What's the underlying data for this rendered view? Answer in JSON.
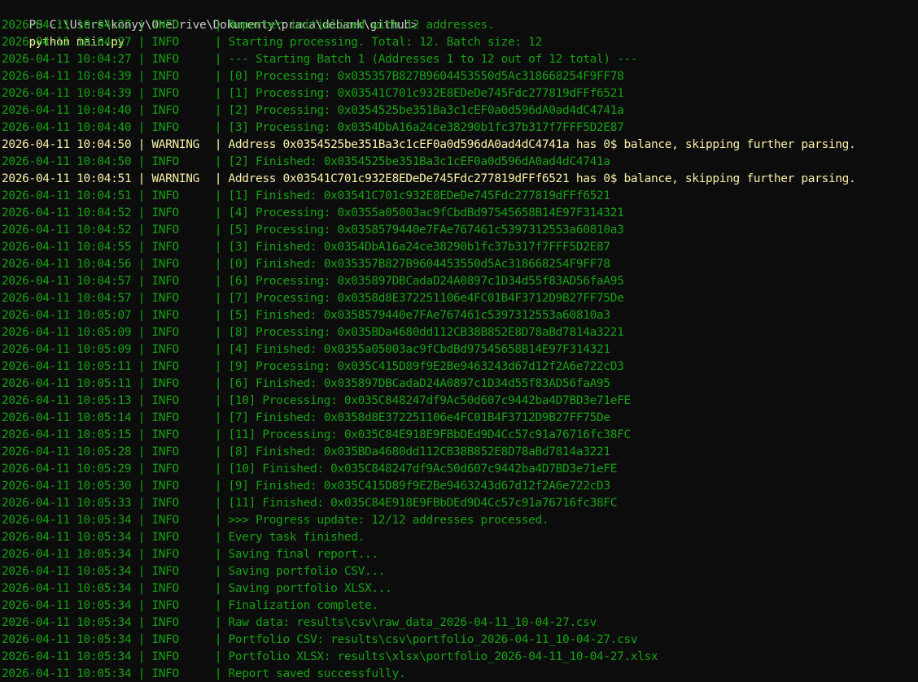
{
  "terminal": {
    "prompt": "PS C:\\Users\\konyy\\OneDrive\\Dokumenty\\praca\\debank\\github>",
    "command": "python main.py",
    "colors": {
      "background": "#0c0c0c",
      "info": "#13a10e",
      "warning": "#f9f1a5",
      "prompt": "#cccccc",
      "command": "#f9f1a5"
    },
    "lines": [
      {
        "ts": "2026-04-11 10:04:27",
        "level": "INFO",
        "msg": "Reporter initialized with 12 addresses."
      },
      {
        "ts": "2026-04-11 10:04:27",
        "level": "INFO",
        "msg": "Starting processing. Total: 12. Batch size: 12"
      },
      {
        "ts": "2026-04-11 10:04:27",
        "level": "INFO",
        "msg": "--- Starting Batch 1 (Addresses 1 to 12 out of 12 total) ---"
      },
      {
        "ts": "2026-04-11 10:04:39",
        "level": "INFO",
        "msg": "[0] Processing: 0x035357B827B9604453550d5Ac318668254F9FF78"
      },
      {
        "ts": "2026-04-11 10:04:39",
        "level": "INFO",
        "msg": "[1] Processing: 0x03541C701c932E8EDeDe745Fdc277819dFFf6521"
      },
      {
        "ts": "2026-04-11 10:04:40",
        "level": "INFO",
        "msg": "[2] Processing: 0x0354525be351Ba3c1cEF0a0d596dA0ad4dC4741a"
      },
      {
        "ts": "2026-04-11 10:04:40",
        "level": "INFO",
        "msg": "[3] Processing: 0x0354DbA16a24ce38290b1fc37b317f7FFF5D2E87"
      },
      {
        "ts": "2026-04-11 10:04:50",
        "level": "WARNING",
        "msg": "Address 0x0354525be351Ba3c1cEF0a0d596dA0ad4dC4741a has 0$ balance, skipping further parsing."
      },
      {
        "ts": "2026-04-11 10:04:50",
        "level": "INFO",
        "msg": "[2] Finished: 0x0354525be351Ba3c1cEF0a0d596dA0ad4dC4741a"
      },
      {
        "ts": "2026-04-11 10:04:51",
        "level": "WARNING",
        "msg": "Address 0x03541C701c932E8EDeDe745Fdc277819dFFf6521 has 0$ balance, skipping further parsing."
      },
      {
        "ts": "2026-04-11 10:04:51",
        "level": "INFO",
        "msg": "[1] Finished: 0x03541C701c932E8EDeDe745Fdc277819dFFf6521"
      },
      {
        "ts": "2026-04-11 10:04:52",
        "level": "INFO",
        "msg": "[4] Processing: 0x0355a05003ac9fCbdBd97545658B14E97F314321"
      },
      {
        "ts": "2026-04-11 10:04:52",
        "level": "INFO",
        "msg": "[5] Processing: 0x0358579440e7FAe767461c5397312553a60810a3"
      },
      {
        "ts": "2026-04-11 10:04:55",
        "level": "INFO",
        "msg": "[3] Finished: 0x0354DbA16a24ce38290b1fc37b317f7FFF5D2E87"
      },
      {
        "ts": "2026-04-11 10:04:56",
        "level": "INFO",
        "msg": "[0] Finished: 0x035357B827B9604453550d5Ac318668254F9FF78"
      },
      {
        "ts": "2026-04-11 10:04:57",
        "level": "INFO",
        "msg": "[6] Processing: 0x035897DBCadaD24A0897c1D34d55f83AD56faA95"
      },
      {
        "ts": "2026-04-11 10:04:57",
        "level": "INFO",
        "msg": "[7] Processing: 0x0358d8E372251106e4FC01B4F3712D9B27FF75De"
      },
      {
        "ts": "2026-04-11 10:05:07",
        "level": "INFO",
        "msg": "[5] Finished: 0x0358579440e7FAe767461c5397312553a60810a3"
      },
      {
        "ts": "2026-04-11 10:05:09",
        "level": "INFO",
        "msg": "[8] Processing: 0x035BDa4680dd112CB38B852E8D78aBd7814a3221"
      },
      {
        "ts": "2026-04-11 10:05:09",
        "level": "INFO",
        "msg": "[4] Finished: 0x0355a05003ac9fCbdBd97545658B14E97F314321"
      },
      {
        "ts": "2026-04-11 10:05:11",
        "level": "INFO",
        "msg": "[9] Processing: 0x035C415D89f9E2Be9463243d67d12f2A6e722cD3"
      },
      {
        "ts": "2026-04-11 10:05:11",
        "level": "INFO",
        "msg": "[6] Finished: 0x035897DBCadaD24A0897c1D34d55f83AD56faA95"
      },
      {
        "ts": "2026-04-11 10:05:13",
        "level": "INFO",
        "msg": "[10] Processing: 0x035C848247df9Ac50d607c9442ba4D7BD3e71eFE"
      },
      {
        "ts": "2026-04-11 10:05:14",
        "level": "INFO",
        "msg": "[7] Finished: 0x0358d8E372251106e4FC01B4F3712D9B27FF75De"
      },
      {
        "ts": "2026-04-11 10:05:15",
        "level": "INFO",
        "msg": "[11] Processing: 0x035C84E918E9FBbDEd9D4Cc57c91a76716fc38FC"
      },
      {
        "ts": "2026-04-11 10:05:28",
        "level": "INFO",
        "msg": "[8] Finished: 0x035BDa4680dd112CB38B852E8D78aBd7814a3221"
      },
      {
        "ts": "2026-04-11 10:05:29",
        "level": "INFO",
        "msg": "[10] Finished: 0x035C848247df9Ac50d607c9442ba4D7BD3e71eFE"
      },
      {
        "ts": "2026-04-11 10:05:30",
        "level": "INFO",
        "msg": "[9] Finished: 0x035C415D89f9E2Be9463243d67d12f2A6e722cD3"
      },
      {
        "ts": "2026-04-11 10:05:33",
        "level": "INFO",
        "msg": "[11] Finished: 0x035C84E918E9FBbDEd9D4Cc57c91a76716fc38FC"
      },
      {
        "ts": "2026-04-11 10:05:34",
        "level": "INFO",
        "msg": ">>> Progress update: 12/12 addresses processed."
      },
      {
        "ts": "2026-04-11 10:05:34",
        "level": "INFO",
        "msg": "Every task finished."
      },
      {
        "ts": "2026-04-11 10:05:34",
        "level": "INFO",
        "msg": "Saving final report..."
      },
      {
        "ts": "2026-04-11 10:05:34",
        "level": "INFO",
        "msg": "Saving portfolio CSV..."
      },
      {
        "ts": "2026-04-11 10:05:34",
        "level": "INFO",
        "msg": "Saving portfolio XLSX..."
      },
      {
        "ts": "2026-04-11 10:05:34",
        "level": "INFO",
        "msg": "Finalization complete."
      },
      {
        "ts": "2026-04-11 10:05:34",
        "level": "INFO",
        "msg": "Raw data: results\\csv\\raw_data_2026-04-11_10-04-27.csv"
      },
      {
        "ts": "2026-04-11 10:05:34",
        "level": "INFO",
        "msg": "Portfolio CSV: results\\csv\\portfolio_2026-04-11_10-04-27.csv"
      },
      {
        "ts": "2026-04-11 10:05:34",
        "level": "INFO",
        "msg": "Portfolio XLSX: results\\xlsx\\portfolio_2026-04-11_10-04-27.xlsx"
      },
      {
        "ts": "2026-04-11 10:05:34",
        "level": "INFO",
        "msg": "Report saved successfully."
      }
    ]
  }
}
